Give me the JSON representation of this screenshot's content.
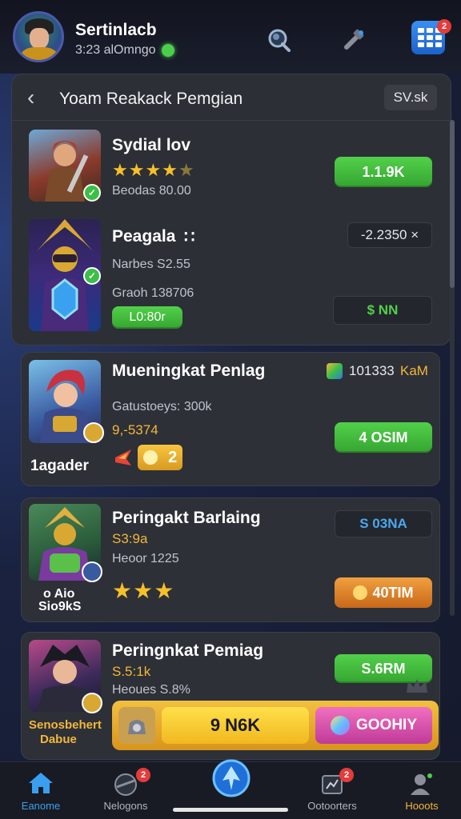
{
  "header": {
    "username": "Sertinlacb",
    "status": "3:23 alOmngo"
  },
  "panel": {
    "title": "Yoam Reakack Pemgian",
    "value": "SV.sk"
  },
  "cards": [
    {
      "name": "Sydial lov",
      "meta1": "Beodas 80.00",
      "button": "1.1.9K",
      "stars_filled": 4,
      "stars_total": 5
    },
    {
      "name": "Peagala",
      "name_suffix": "∷",
      "meta1": "Narbes S2.55",
      "meta2": "Graoh 138706",
      "tag": "L0:80r",
      "pill": "-2.2350 ×",
      "pill2": "$ NN"
    },
    {
      "name": "Mueningkat Penlag",
      "meta1": "Gatustoeys: 300k",
      "meta_gold": "9,-5374",
      "counter": "101333",
      "counter2": "KaM",
      "button": "4 OSIM",
      "badge": "2",
      "portrait_caption": "1agader"
    },
    {
      "name": "Peringakt Barlaing",
      "meta1": "S3:9a",
      "meta2": "Heoor 1225",
      "pill": "S 03NA",
      "button": "40TIM",
      "portrait_caption_1": "o Aio",
      "portrait_caption_2": "Sio9kS",
      "stars_filled": 3
    },
    {
      "name": "Peringnkat Pemiag",
      "meta_gold": "S.5:1k",
      "meta1": "Heoues S.8%",
      "button": "S.6RM",
      "portrait_caption_1": "Senosbehert",
      "portrait_caption_2": "Dabue"
    }
  ],
  "action_bar": {
    "primary": "9 N6K",
    "secondary": "GOOHIY"
  },
  "nav": {
    "items": [
      {
        "label": "Eanome",
        "icon": "home-icon",
        "badge": ""
      },
      {
        "label": "Nelogons",
        "icon": "planet-icon",
        "badge": "2"
      },
      {
        "label": "",
        "icon": "shield-icon",
        "badge": ""
      },
      {
        "label": "Ootoorters",
        "icon": "chart-icon",
        "badge": "2"
      },
      {
        "label": "Hooots",
        "icon": "profile-icon",
        "badge": ""
      }
    ]
  },
  "badges": {
    "menu": "2"
  },
  "colors": {
    "accent_green": "#45c43f",
    "accent_gold": "#f3b73a",
    "accent_blue": "#2e7be0",
    "panel": "#2c2f36"
  }
}
